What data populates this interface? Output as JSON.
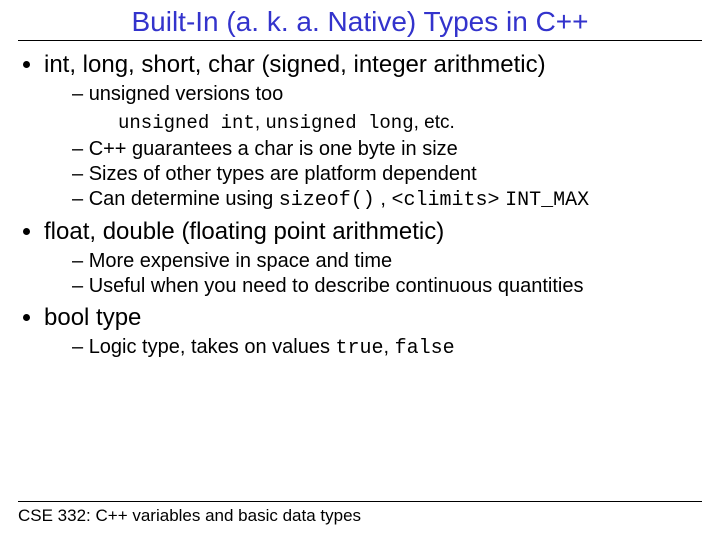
{
  "title": "Built-In (a. k. a. Native) Types in C++",
  "b1": {
    "head": "int, long, short, char (signed, integer arithmetic)",
    "s1": "unsigned versions too",
    "code1a": "unsigned int",
    "code1sep": ", ",
    "code1b": "unsigned long",
    "code1tail": ", etc.",
    "s2a": "C++ guarantees a char is one byte in size",
    "s2b": "Sizes of other types are platform dependent",
    "s2c_pre": "Can determine using ",
    "s2c_code1": "sizeof()",
    "s2c_mid": " , ",
    "s2c_code2": "<climits>",
    "s2c_sp": " ",
    "s2c_code3": "INT_MAX"
  },
  "b2": {
    "head": "float, double (floating point arithmetic)",
    "s1": "More expensive in space and time",
    "s2": "Useful when you need to describe continuous quantities"
  },
  "b3": {
    "head": "bool type",
    "s1_pre": "Logic type, takes on values ",
    "s1_code1": "true",
    "s1_mid": ", ",
    "s1_code2": "false"
  },
  "footer": "CSE 332: C++ variables and basic data types"
}
